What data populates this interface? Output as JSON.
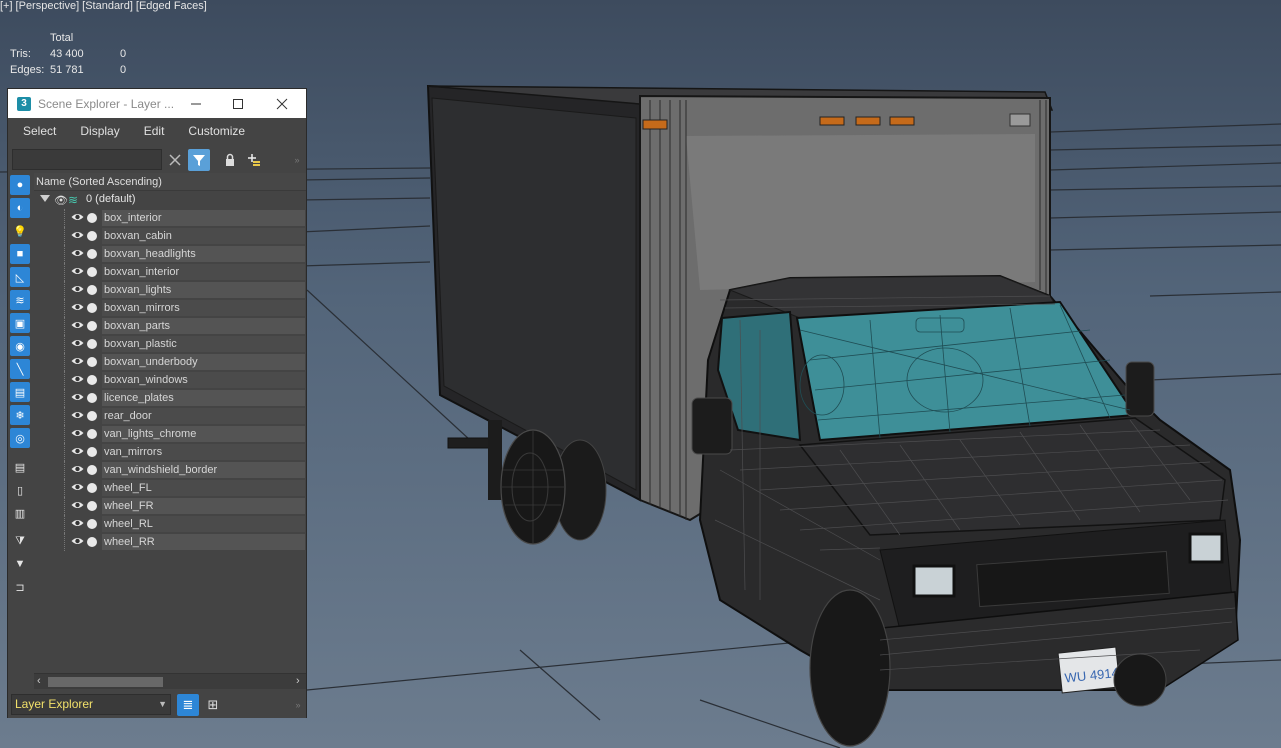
{
  "viewport": {
    "labels": [
      "[+]",
      "[Perspective]",
      "[Standard]",
      "[Edged Faces]"
    ],
    "stats": {
      "header": "Total",
      "rows": [
        {
          "label": "Tris:",
          "value": "43 400",
          "selected": "0"
        },
        {
          "label": "Edges:",
          "value": "51 781",
          "selected": "0"
        }
      ]
    },
    "license_plate_text": "WU 4914"
  },
  "explorer": {
    "title": "Scene Explorer - Layer ...",
    "app_icon": "3",
    "menu": [
      "Select",
      "Display",
      "Edit",
      "Customize"
    ],
    "search_placeholder": "",
    "column_header": "Name (Sorted Ascending)",
    "layer_name": "0 (default)",
    "objects": [
      "box_interior",
      "boxvan_cabin",
      "boxvan_headlights",
      "boxvan_interior",
      "boxvan_lights",
      "boxvan_mirrors",
      "boxvan_parts",
      "boxvan_plastic",
      "boxvan_underbody",
      "boxvan_windows",
      "licence_plates",
      "rear_door",
      "van_lights_chrome",
      "van_mirrors",
      "van_windshield_border",
      "wheel_FL",
      "wheel_FR",
      "wheel_RL",
      "wheel_RR"
    ],
    "explorer_type": "Layer Explorer"
  },
  "colors": {
    "accent_blue": "#2d86d6",
    "layer_teal": "#48c9b0",
    "explorer_label_yellow": "#f1e06a",
    "glass_teal": "#3e8f98"
  },
  "icons": {
    "strip": [
      "geometry-filter-icon",
      "shapes-filter-icon",
      "lights-filter-icon",
      "cameras-filter-icon",
      "helpers-filter-icon",
      "spacewarps-filter-icon",
      "groups-filter-icon",
      "xrefs-filter-icon",
      "bones-filter-icon",
      "containers-filter-icon",
      "frozen-filter-icon",
      "hidden-filter-icon",
      "display-all-icon",
      "display-none-icon",
      "invert-display-icon",
      "filter-funnel-icon",
      "funnel-icon",
      "sync-selection-icon"
    ]
  }
}
